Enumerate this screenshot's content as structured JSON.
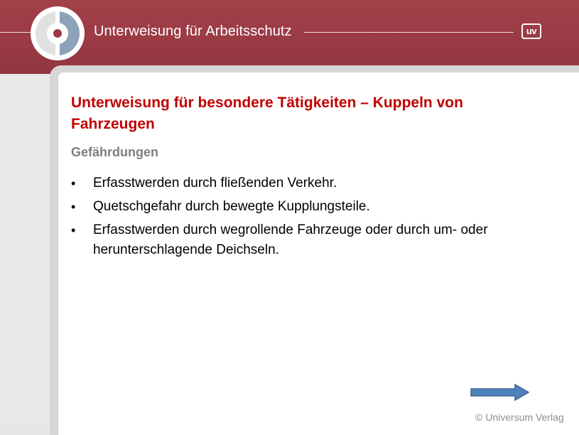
{
  "header": {
    "title": "Unterweisung für Arbeitsschutz",
    "badge": "uv",
    "logo_icon": "ring-logo-icon"
  },
  "slide": {
    "title": "Unterweisung für besondere Tätigkeiten – Kuppeln von Fahrzeugen",
    "subtitle": "Gefährdungen",
    "bullets": [
      "Erfasstwerden durch fließenden Verkehr.",
      "Quetschgefahr durch bewegte Kupplungsteile.",
      "Erfasstwerden durch wegrollende Fahrzeuge oder durch um- oder herunterschlagende Deichseln."
    ],
    "bullet_symbol": "•"
  },
  "navigation": {
    "next_icon": "arrow-right-icon"
  },
  "footer": {
    "copyright": "© Universum Verlag"
  },
  "colors": {
    "header_red": "#9b3a44",
    "title_red": "#c00000",
    "subtitle_gray": "#7f7f7f",
    "arrow_blue": "#4f81bd"
  }
}
